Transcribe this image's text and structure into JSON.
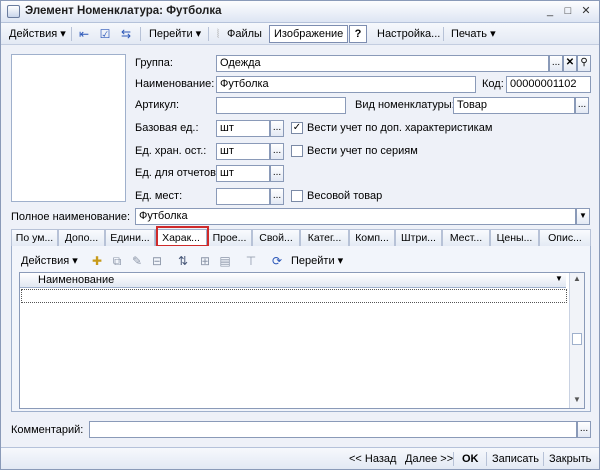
{
  "window": {
    "title": "Элемент Номенклатура: Футболка",
    "controls": {
      "minimize": "_",
      "maximize": "□",
      "close": "✕"
    }
  },
  "toolbar": {
    "actions": "Действия",
    "goto": "Перейти",
    "files": "Файлы",
    "image": "Изображение",
    "help": "?",
    "settings": "Настройка...",
    "print": "Печать"
  },
  "form": {
    "group_label": "Группа:",
    "group_value": "Одежда",
    "name_label": "Наименование:",
    "name_value": "Футболка",
    "code_label": "Код:",
    "code_value": "00000001102",
    "article_label": "Артикул:",
    "article_value": "",
    "type_label": "Вид номенклатуры:",
    "type_value": "Товар",
    "base_unit_label": "Базовая ед.:",
    "base_unit_value": "шт",
    "storage_unit_label": "Ед. хран. ост.:",
    "storage_unit_value": "шт",
    "report_unit_label": "Ед. для отчетов:",
    "report_unit_value": "шт",
    "place_unit_label": "Ед. мест:",
    "place_unit_value": "",
    "extra_chars_label": "Вести учет по доп. характеристикам",
    "extra_chars_checked": true,
    "series_label": "Вести учет по сериям",
    "series_checked": false,
    "weight_label": "Весовой товар",
    "weight_checked": false,
    "full_name_label": "Полное наименование:",
    "full_name_value": "Футболка",
    "dots": "...",
    "clear": "✕",
    "search": "⚲",
    "dropdown": "▼"
  },
  "tabs": [
    {
      "label": "По ум..."
    },
    {
      "label": "Допо..."
    },
    {
      "label": "Едини..."
    },
    {
      "label": "Харак..."
    },
    {
      "label": "Прое..."
    },
    {
      "label": "Свой..."
    },
    {
      "label": "Катег..."
    },
    {
      "label": "Комп..."
    },
    {
      "label": "Штри..."
    },
    {
      "label": "Мест..."
    },
    {
      "label": "Цены..."
    },
    {
      "label": "Опис..."
    }
  ],
  "active_tab_index": 3,
  "panel": {
    "actions": "Действия",
    "goto": "Перейти",
    "column_name": "Наименование"
  },
  "comment": {
    "label": "Комментарий:",
    "value": ""
  },
  "footer": {
    "back": "<< Назад",
    "next": "Далее >>",
    "ok": "OK",
    "save": "Записать",
    "close": "Закрыть"
  },
  "colors": {
    "highlight": "#cf2a2a",
    "window_bg": "#eef1f8"
  }
}
